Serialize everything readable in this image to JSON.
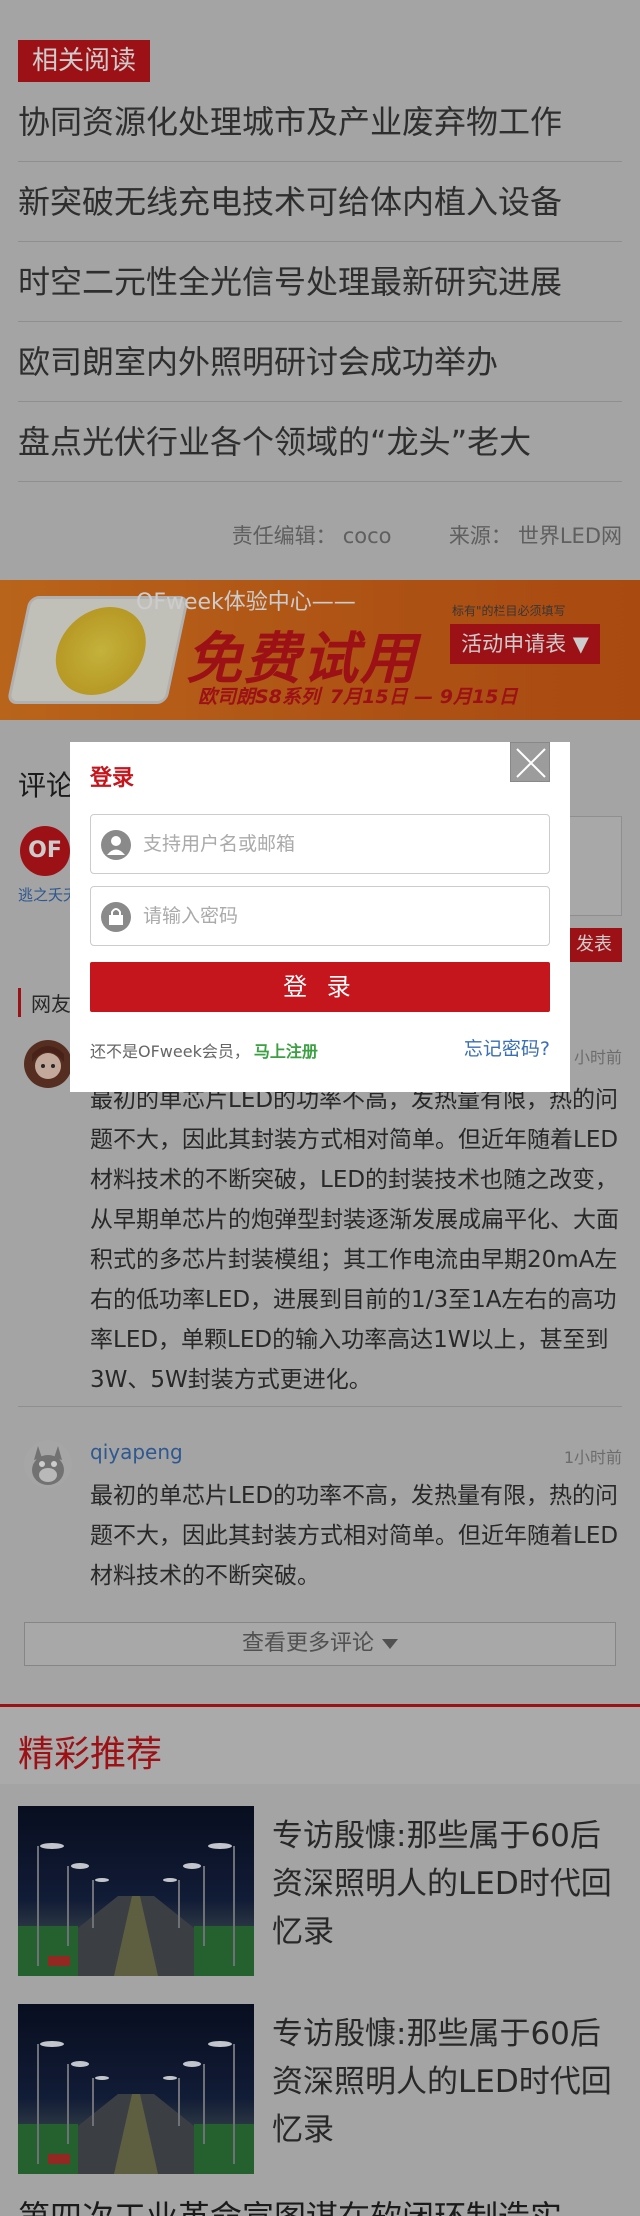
{
  "related": {
    "heading": "相关阅读",
    "items": [
      "协同资源化处理城市及产业废弃物工作",
      "新突破无线充电技术可给体内植入设备",
      "时空二元性全光信号处理最新研究进展",
      "欧司朗室内外照明研讨会成功举办",
      "盘点光伏行业各个领域的“龙头”老大"
    ],
    "editor_label": "责任编辑：",
    "editor": "coco",
    "source_label": "来源：",
    "source": "世界LED网"
  },
  "banner": {
    "top_text": "OFweek体验中心——",
    "big_text": "免费试用",
    "note": "标有\"的栏目必须填写",
    "button": "活动申请表 ▼",
    "series": "欧司朗S8系列",
    "dates": "7月15日 — 9月15日"
  },
  "comments_section": {
    "title": "评论",
    "avatar_text": "OF",
    "user": "逃之夭夭",
    "submit": "发表",
    "netizen_label": "网友"
  },
  "comments": [
    {
      "name": "",
      "time": "小时前",
      "text": "最初的单芯片LED的功率不高，发热量有限，热的问题不大，因此其封装方式相对简单。但近年随着LED材料技术的不断突破，LED的封装技术也随之改变，从早期单芯片的炮弹型封装逐渐发展成扁平化、大面积式的多芯片封装模组；其工作电流由早期20mA左右的低功率LED，进展到目前的1/3至1A左右的高功率LED，单颗LED的输入功率高达1W以上，甚至到3W、5W封装方式更进化。"
    },
    {
      "name": "qiyapeng",
      "time": "1小时前",
      "text": "最初的单芯片LED的功率不高，发热量有限，热的问题不大，因此其封装方式相对简单。但近年随着LED材料技术的不断突破。"
    }
  ],
  "more_comments": "查看更多评论",
  "recommend": {
    "title": "精彩推荐",
    "items": [
      "专访殷慷:那些属于60后资深照明人的LED时代回忆录",
      "专访殷慷:那些属于60后资深照明人的LED时代回忆录"
    ],
    "partial": "第四次工业革命宣图谋在软闭环制造实"
  },
  "modal": {
    "title": "登录",
    "username_placeholder": "支持用户名或邮箱",
    "password_placeholder": "请输入密码",
    "login_button": "登 录",
    "not_member": "还不是OFweek会员，",
    "register": "马上注册",
    "forgot": "忘记密码?"
  },
  "colors": {
    "brand_red": "#c4161c",
    "link_blue": "#3a6eb5",
    "register_green": "#3aa042",
    "banner_orange": "#e87d22"
  }
}
